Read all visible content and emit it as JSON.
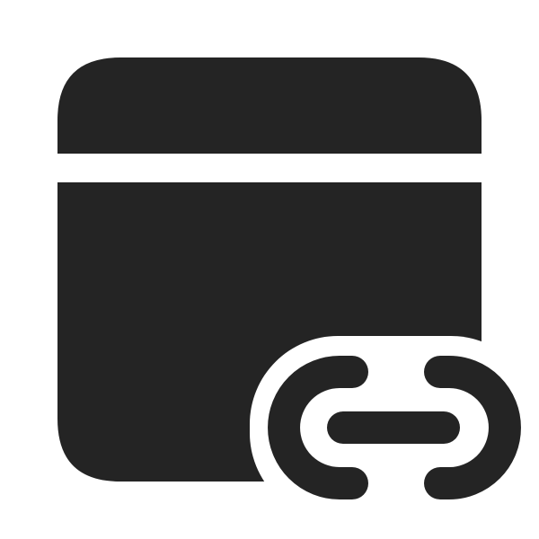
{
  "icon": {
    "name": "window-link-icon",
    "color": "#242424",
    "background": "#ffffff"
  }
}
